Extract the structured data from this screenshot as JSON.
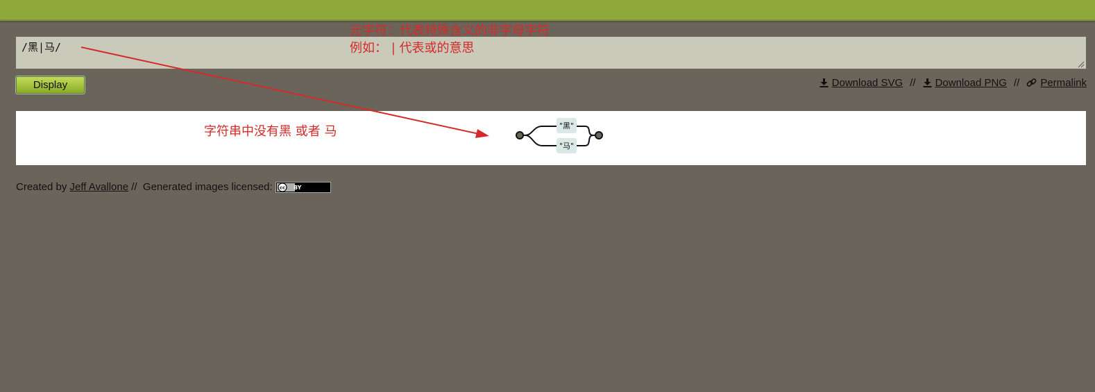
{
  "input": {
    "value": "/黑|马/"
  },
  "display_button": {
    "label": "Display"
  },
  "links": {
    "download_svg": "Download SVG",
    "download_png": "Download PNG",
    "permalink": "Permalink",
    "separator": "//"
  },
  "diagram": {
    "option1": "\"黑\"",
    "option2": "\"马\""
  },
  "footer": {
    "created_by": "Created by",
    "author": "Jeff Avallone",
    "separator": "//",
    "license_text": "Generated images licensed:",
    "badge_text": "BY"
  },
  "annotations": {
    "meta_line1": "元字符：代表特殊含义的非字母字符",
    "meta_line2": "例如：  |  代表或的意思",
    "explain": "字符串中没有黑  或者  马",
    "color": "#d42a2a"
  },
  "colors": {
    "topbar": "#8fa83c",
    "page_background": "#6b645a",
    "input_background": "#cacabb",
    "button": "#a6c23e",
    "panel": "#ffffff"
  }
}
